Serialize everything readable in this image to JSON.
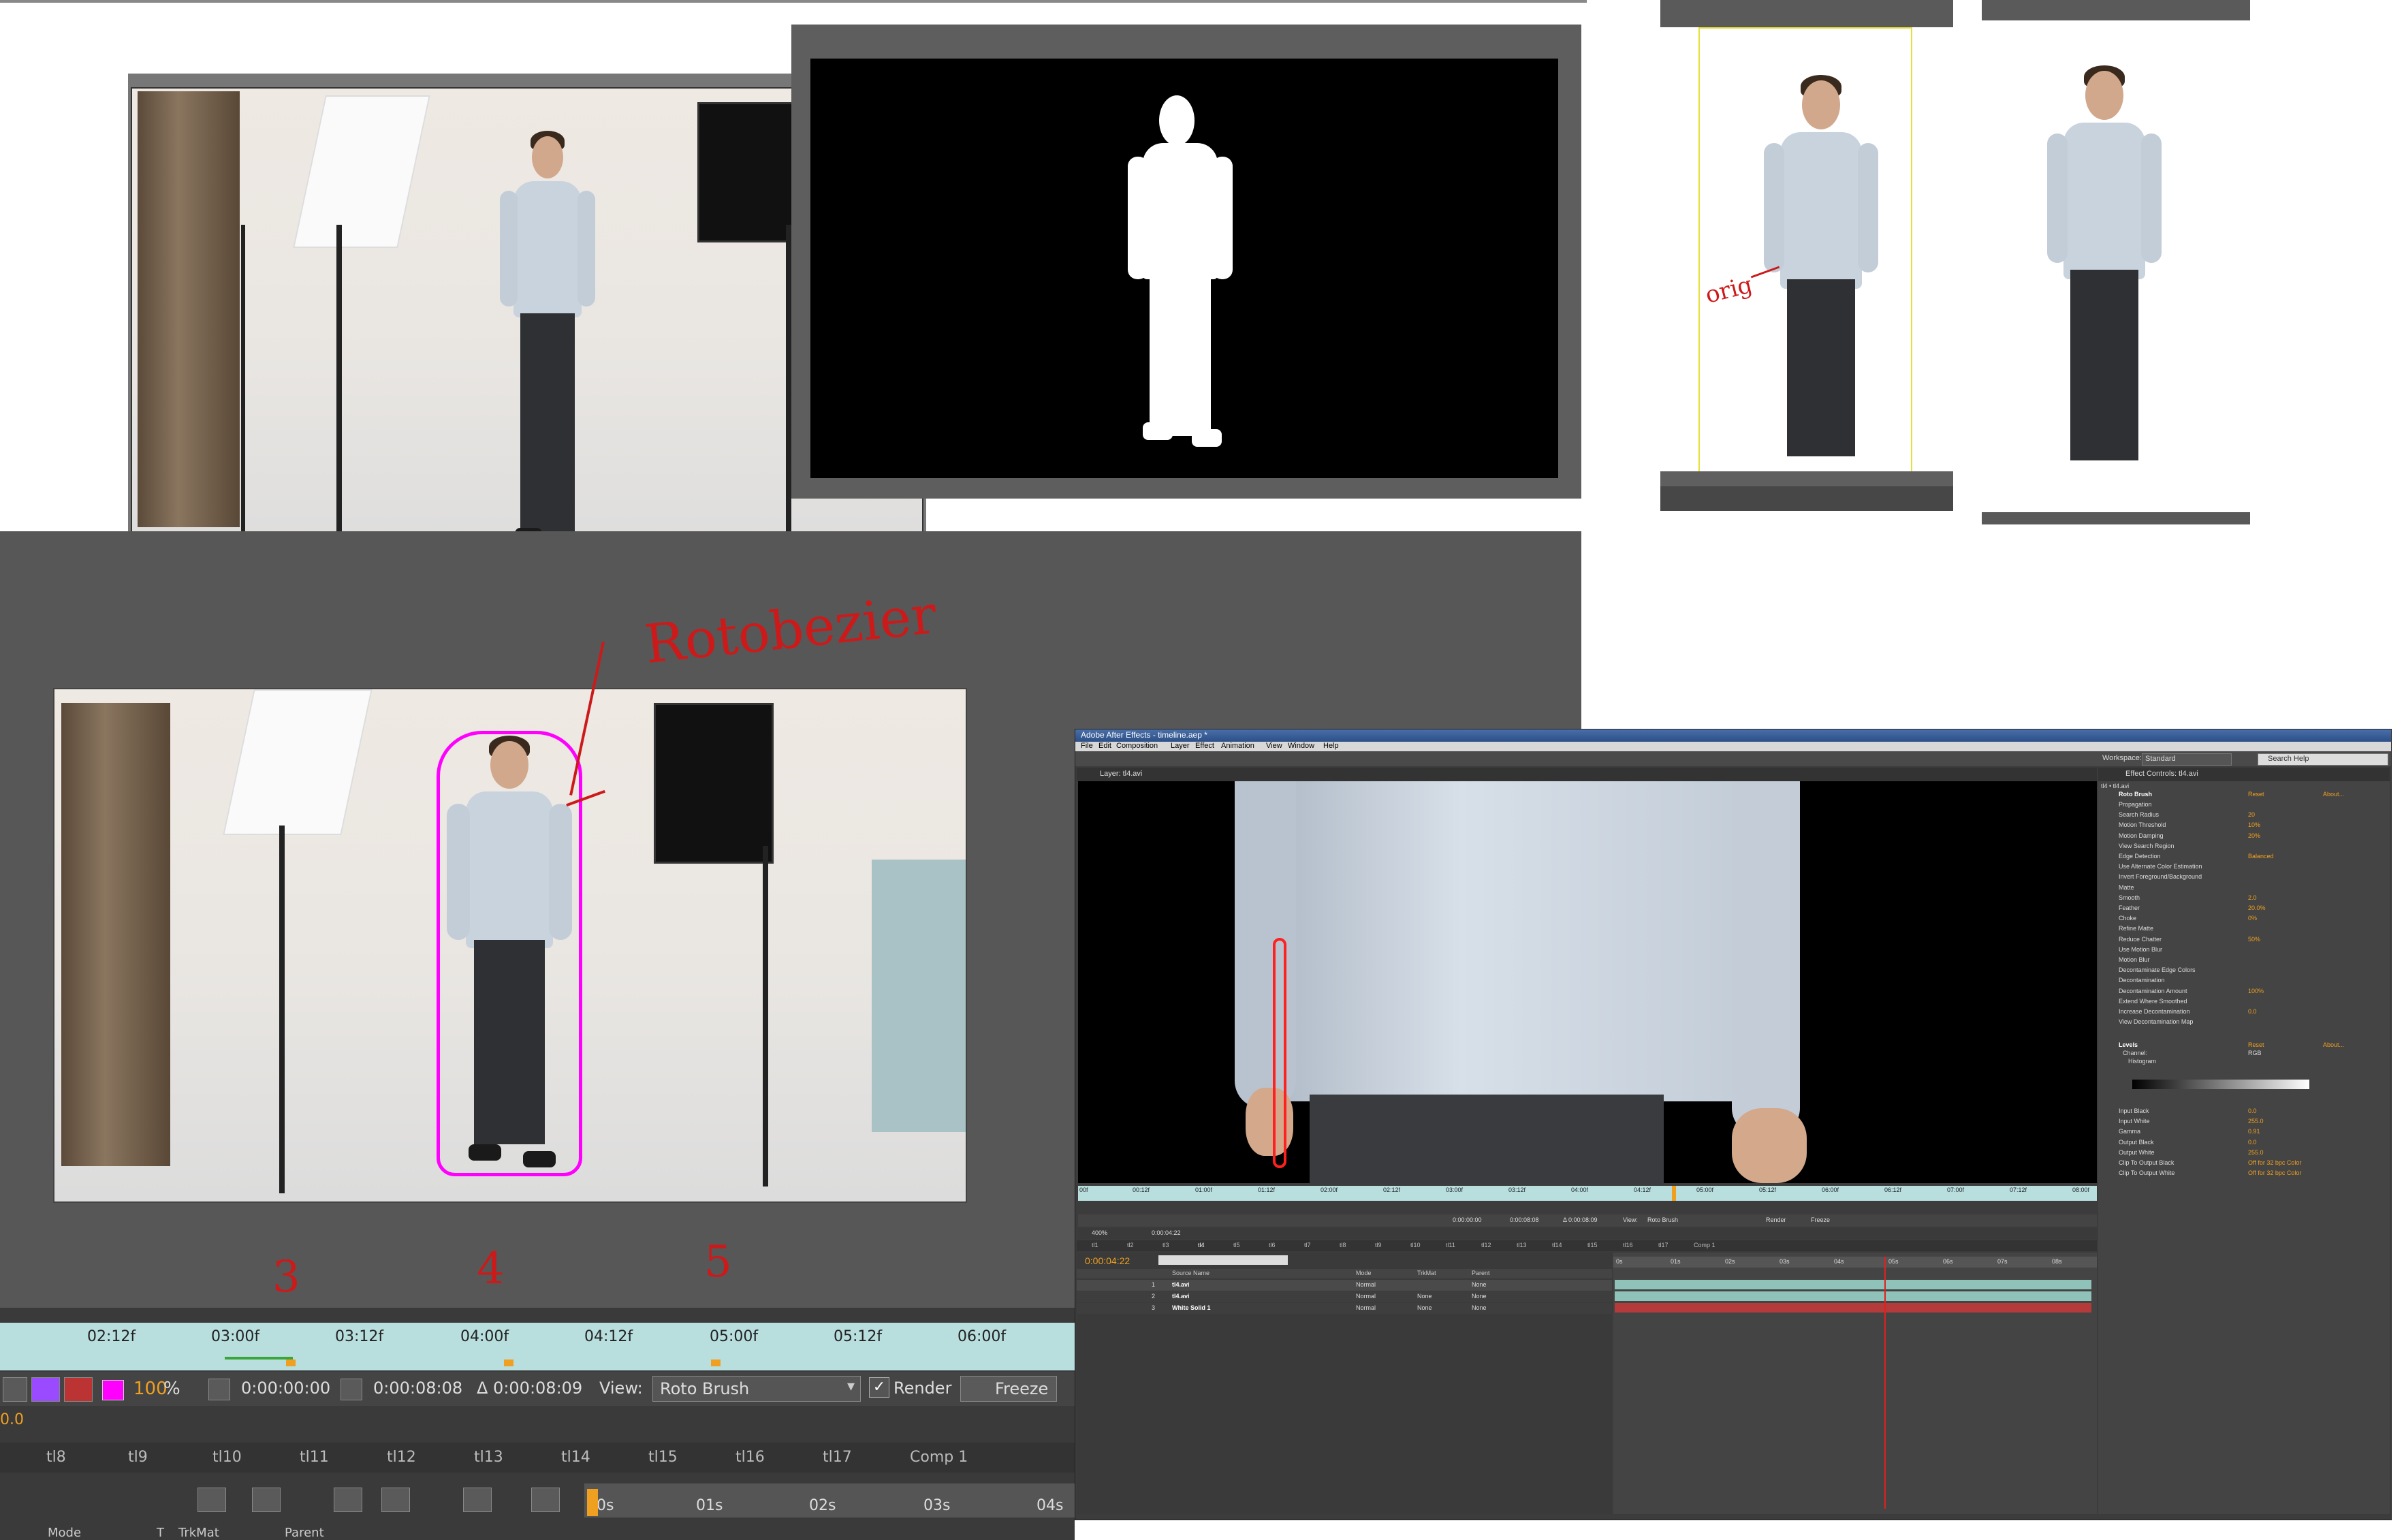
{
  "annotations": {
    "rotobezier": "Rotobezier",
    "orig": "orig",
    "marker_3": "3",
    "marker_4": "4",
    "marker_5": "5"
  },
  "bottom_timeline": {
    "ruler_labels": [
      "02:12f",
      "03:00f",
      "03:12f",
      "04:00f",
      "04:12f",
      "05:00f",
      "05:12f",
      "06:00f"
    ],
    "zoom_percent": "100",
    "percent_sign": "%",
    "start_time": "0:00:00:00",
    "end_time": "0:00:08:08",
    "duration": "Δ 0:00:08:09",
    "view_label": "View:",
    "view_value": "Roto Brush",
    "render_label": "Render",
    "freeze_label": "Freeze",
    "side_value": "0.0",
    "tabs": [
      "tl8",
      "tl9",
      "tl10",
      "tl11",
      "tl12",
      "tl13",
      "tl14",
      "tl15",
      "tl16",
      "tl17",
      "Comp 1"
    ],
    "time_labels": [
      "0s",
      "01s",
      "02s",
      "03s",
      "04s"
    ],
    "col_mode": "Mode",
    "col_t": "T",
    "col_trkmat": "TrkMat",
    "col_parent": "Parent"
  },
  "ae_window": {
    "title": "Adobe After Effects - timeline.aep *",
    "menu": [
      "File",
      "Edit",
      "Composition",
      "Layer",
      "Effect",
      "Animation",
      "View",
      "Window",
      "Help"
    ],
    "workspace_label": "Workspace:",
    "workspace_value": "Standard",
    "search_help": "Search Help",
    "layer_tab": "Layer: tl4.avi",
    "effect_controls_tab": "Effect Controls: tl4.avi",
    "effect_layer": "tl4 • tl4.avi",
    "roto_brush": "Roto Brush",
    "reset": "Reset",
    "about": "About...",
    "effect_rows": [
      {
        "label": "Propagation",
        "value": ""
      },
      {
        "label": "Search Radius",
        "value": "20"
      },
      {
        "label": "Motion Threshold",
        "value": "10%"
      },
      {
        "label": "Motion Damping",
        "value": "20%"
      },
      {
        "label": "View Search Region",
        "value": ""
      },
      {
        "label": "Edge Detection",
        "value": "Balanced"
      },
      {
        "label": "Use Alternate Color Estimation",
        "value": ""
      },
      {
        "label": "Invert Foreground/Background",
        "value": ""
      },
      {
        "label": "Matte",
        "value": ""
      },
      {
        "label": "Smooth",
        "value": "2.0"
      },
      {
        "label": "Feather",
        "value": "20.0%"
      },
      {
        "label": "Choke",
        "value": "0%"
      },
      {
        "label": "Refine Matte",
        "value": ""
      },
      {
        "label": "Reduce Chatter",
        "value": "50%"
      },
      {
        "label": "Use Motion Blur",
        "value": ""
      },
      {
        "label": "Motion Blur",
        "value": ""
      },
      {
        "label": "Decontaminate Edge Colors",
        "value": ""
      },
      {
        "label": "Decontamination",
        "value": ""
      },
      {
        "label": "Decontamination Amount",
        "value": "100%"
      },
      {
        "label": "Extend Where Smoothed",
        "value": ""
      },
      {
        "label": "Increase Decontamination",
        "value": "0.0"
      },
      {
        "label": "View Decontamination Map",
        "value": ""
      }
    ],
    "levels": "Levels",
    "channel_label": "Channel:",
    "channel_value": "RGB",
    "histogram": "Histogram",
    "levels_rows": [
      {
        "label": "Input Black",
        "value": "0.0"
      },
      {
        "label": "Input White",
        "value": "255.0"
      },
      {
        "label": "Gamma",
        "value": "0.91"
      },
      {
        "label": "Output Black",
        "value": "0.0"
      },
      {
        "label": "Output White",
        "value": "255.0"
      },
      {
        "label": "Clip To Output Black",
        "value": "Off for 32 bpc Color"
      },
      {
        "label": "Clip To Output White",
        "value": "Off for 32 bpc Color"
      }
    ],
    "viewer_ruler": [
      "00f",
      "00:12f",
      "01:00f",
      "01:12f",
      "02:00f",
      "02:12f",
      "03:00f",
      "03:12f",
      "04:00f",
      "04:12f",
      "05:00f",
      "05:12f",
      "06:00f",
      "06:12f",
      "07:00f",
      "07:12f",
      "08:00f"
    ],
    "viewer_zoom": "400%",
    "viewer_time": "0:00:04:22",
    "viewer_start": "0:00:00:00",
    "viewer_end": "0:00:08:08",
    "viewer_duration": "Δ 0:00:08:09",
    "viewer_view_label": "View:",
    "viewer_view_value": "Roto Brush",
    "viewer_render": "Render",
    "viewer_freeze": "Freeze",
    "comp_tabs": [
      "tl1",
      "tl2",
      "tl3",
      "tl4",
      "tl5",
      "tl6",
      "tl7",
      "tl8",
      "tl9",
      "tl10",
      "tl11",
      "tl12",
      "tl13",
      "tl14",
      "tl15",
      "tl16",
      "tl17",
      "Comp 1"
    ],
    "current_time": "0:00:04:22",
    "layer_header": "Source Name",
    "mode_header": "Mode",
    "trkmat_header": "TrkMat",
    "parent_header": "Parent",
    "layers": [
      {
        "num": "1",
        "name": "tl4.avi",
        "mode": "Normal",
        "trkmat": "",
        "parent": "None"
      },
      {
        "num": "2",
        "name": "tl4.avi",
        "mode": "Normal",
        "trkmat": "None",
        "parent": "None"
      },
      {
        "num": "3",
        "name": "White Solid 1",
        "mode": "Normal",
        "trkmat": "None",
        "parent": "None"
      }
    ],
    "comp_ruler": [
      "0s",
      "01s",
      "02s",
      "03s",
      "04s",
      "05s",
      "06s",
      "07s",
      "08s"
    ]
  },
  "colors": {
    "panel_gray": "#595959",
    "ae_dark": "#3a3a3a",
    "timeline_teal": "#b8dede",
    "accent_orange": "#f0a020",
    "annotation_red": "#cc1a1a",
    "magenta": "#ff00ff"
  }
}
